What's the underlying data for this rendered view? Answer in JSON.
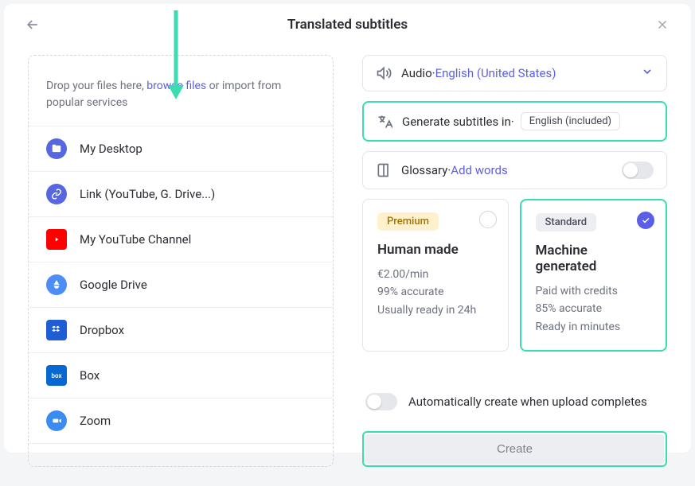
{
  "header": {
    "title": "Translated subtitles"
  },
  "drop": {
    "pre": "Drop your files here, ",
    "browse": "browse files",
    "post": " or import from popular services"
  },
  "services": [
    {
      "label": "My Desktop",
      "icon": "desktop"
    },
    {
      "label": "Link (YouTube, G. Drive...)",
      "icon": "link"
    },
    {
      "label": "My YouTube Channel",
      "icon": "youtube"
    },
    {
      "label": "Google Drive",
      "icon": "gdrive"
    },
    {
      "label": "Dropbox",
      "icon": "dropbox"
    },
    {
      "label": "Box",
      "icon": "box"
    },
    {
      "label": "Zoom",
      "icon": "zoom"
    }
  ],
  "audio": {
    "label": "Audio",
    "sep": " · ",
    "value": "English (United States)"
  },
  "generate": {
    "label": "Generate subtitles in",
    "sep": " · ",
    "pill": "English (included)"
  },
  "glossary": {
    "label": "Glossary",
    "sep": " · ",
    "link": "Add words"
  },
  "plans": {
    "left": {
      "badge": "Premium",
      "title": "Human made",
      "line1": "€2.00/min",
      "line2": "99% accurate",
      "line3": "Usually ready in 24h",
      "selected": false
    },
    "right": {
      "badge": "Standard",
      "title": "Machine generated",
      "line1": "Paid with credits",
      "line2": "85% accurate",
      "line3": "Ready in minutes",
      "selected": true
    }
  },
  "auto": {
    "label": "Automatically create when upload completes"
  },
  "create": {
    "label": "Create"
  },
  "colors": {
    "highlight": "#3bdcb0",
    "accent": "#5b5ee7"
  }
}
